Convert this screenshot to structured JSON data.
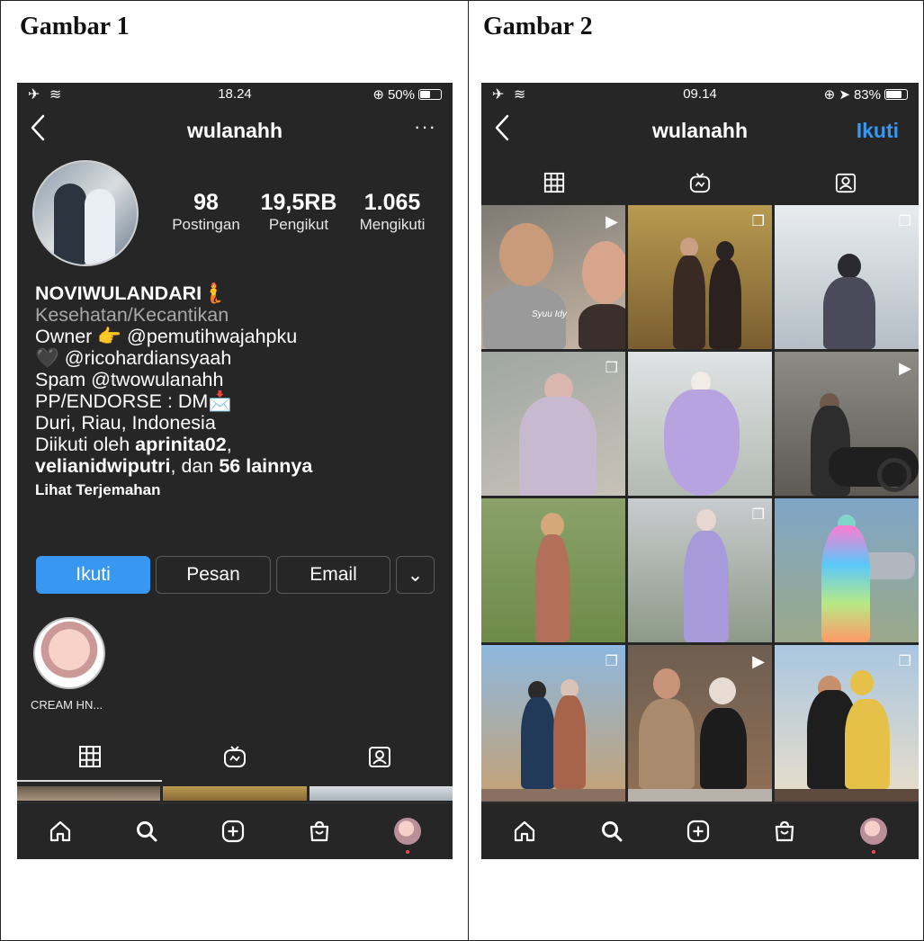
{
  "captions": {
    "left": "Gambar 1",
    "right": "Gambar 2"
  },
  "colors": {
    "background": "#262626",
    "accent": "#3897f0",
    "notification_dot": "#ed4956",
    "secondary_text": "#a8a8a8"
  },
  "screen1": {
    "status": {
      "left_icons": "airplane-icon wifi-icon",
      "time": "18.24",
      "battery_text": "50%",
      "battery_level": 0.5
    },
    "username": "wulanahh",
    "more_label": "···",
    "stats": [
      {
        "number": "98",
        "label": "Postingan"
      },
      {
        "number": "19,5RB",
        "label": "Pengikut"
      },
      {
        "number": "1.065",
        "label": "Mengikuti"
      }
    ],
    "bio": {
      "name": "NOVIWULANDARI🧜",
      "category": "Kesehatan/Kecantikan",
      "line1": "Owner 👉 @pemutihwajahpku",
      "line2": "🖤 @ricohardiansyaah",
      "line3": "Spam @twowulanahh",
      "line4": "PP/ENDORSE : DM📩",
      "line5": "Duri, Riau, Indonesia",
      "followed_prefix": "Diikuti oleh ",
      "followed_user1": "aprinita02",
      "followed_comma": ",",
      "followed_user2": "velianidwiputri",
      "followed_middle": ", dan ",
      "followed_count": "56 lainnya",
      "translate": "Lihat Terjemahan"
    },
    "buttons": {
      "follow": "Ikuti",
      "message": "Pesan",
      "email": "Email",
      "more": "⌄"
    },
    "highlight": {
      "label": "CREAM HN..."
    }
  },
  "screen2": {
    "status": {
      "left_icons": "airplane-icon wifi-icon",
      "time": "09.14",
      "battery_text": "83%",
      "battery_level": 0.83
    },
    "username": "wulanahh",
    "follow_label": "Ikuti",
    "grid": [
      {
        "desc": "couple-selfie",
        "badge": "reel-icon",
        "caption_text": "Syuu Idy"
      },
      {
        "desc": "couple-batik",
        "badge": "carousel-icon"
      },
      {
        "desc": "woman-white-room",
        "badge": "carousel-icon"
      },
      {
        "desc": "woman-pastel",
        "badge": "carousel-icon"
      },
      {
        "desc": "woman-purple-dress",
        "badge": ""
      },
      {
        "desc": "man-motorcycle",
        "badge": "reel-icon"
      },
      {
        "desc": "woman-field",
        "badge": ""
      },
      {
        "desc": "woman-lilac",
        "badge": "carousel-icon"
      },
      {
        "desc": "woman-colorful-dress",
        "badge": ""
      },
      {
        "desc": "couple-seaside",
        "badge": "carousel-icon"
      },
      {
        "desc": "couple-cafe",
        "badge": "reel-icon"
      },
      {
        "desc": "couple-beach",
        "badge": "carousel-icon"
      }
    ]
  }
}
